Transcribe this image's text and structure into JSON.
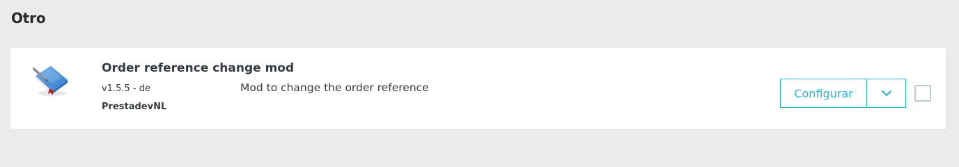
{
  "section": {
    "title": "Otro"
  },
  "module": {
    "icon": "book-with-pencil-icon",
    "name": "Order reference change mod",
    "version_line": "v1.5.5 - de",
    "author": "PrestadevNL",
    "description": "Mod to change the order reference",
    "actions": {
      "configure_label": "Configurar",
      "dropdown_icon": "chevron-down-icon"
    }
  },
  "colors": {
    "accent": "#25b9d7",
    "page_background": "#ebebeb",
    "card_background": "#ffffff",
    "text": "#363a41",
    "checkbox_border": "#bbcdd2"
  }
}
